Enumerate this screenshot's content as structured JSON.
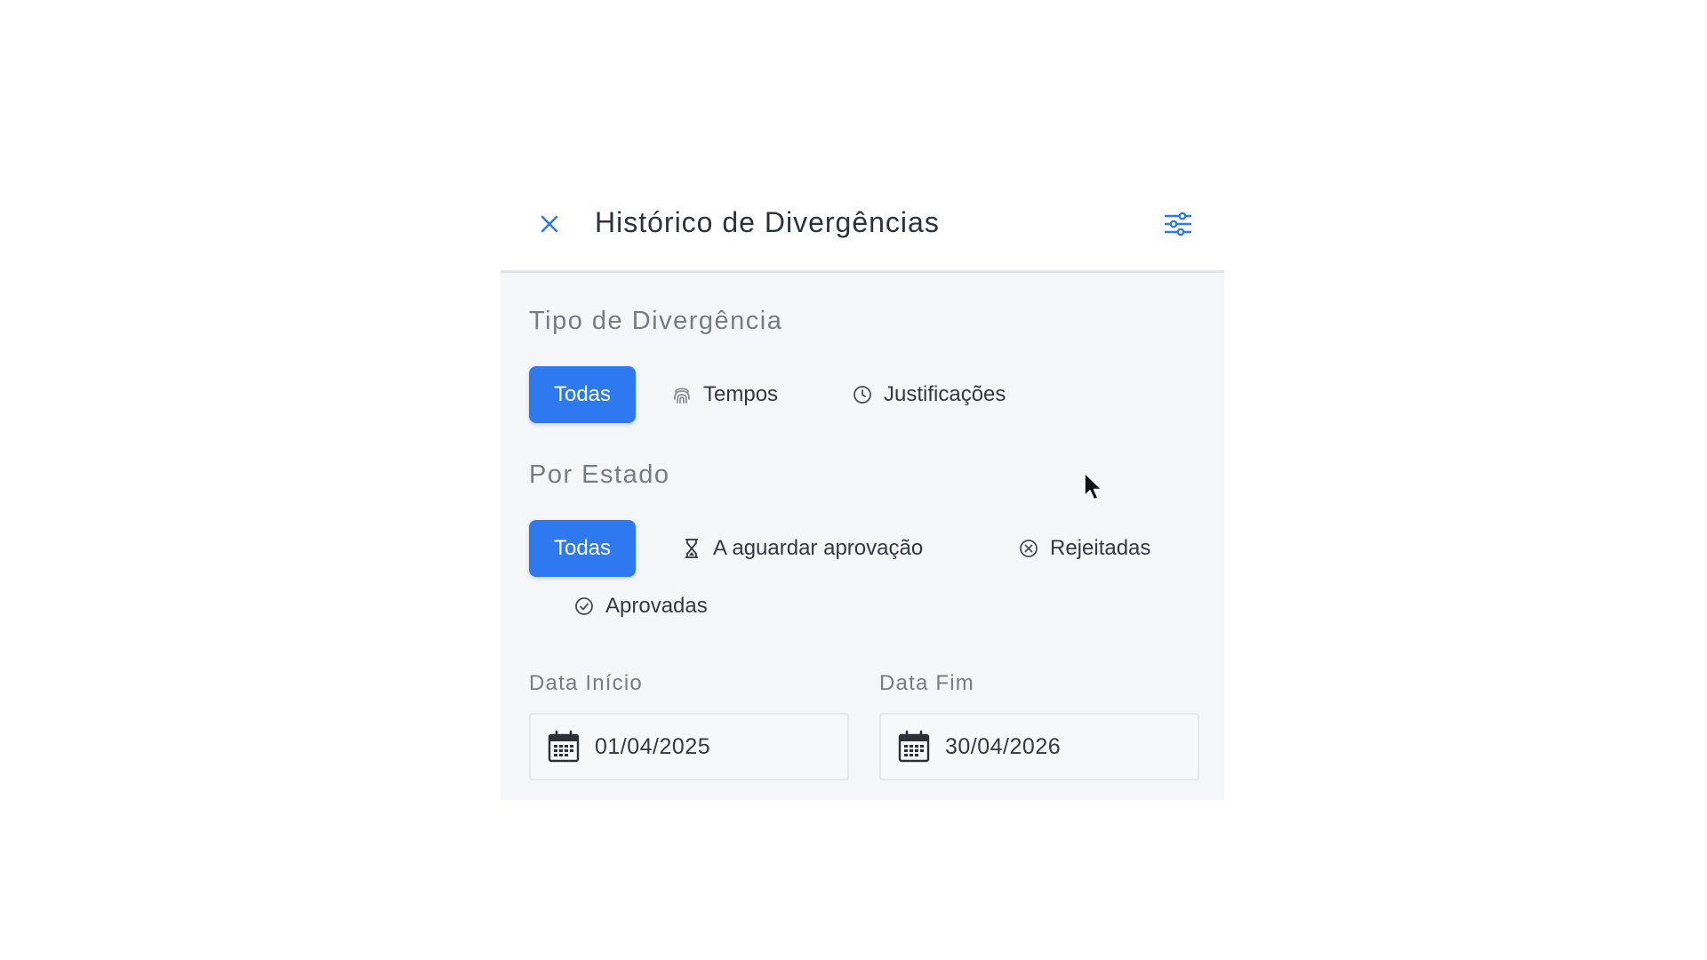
{
  "header": {
    "title": "Histórico de Divergências",
    "close_icon": "close-icon",
    "filter_icon": "sliders-icon",
    "accent": "#2e78f0"
  },
  "type_section": {
    "title": "Tipo de Divergência",
    "chips": [
      {
        "label": "Todas",
        "active": true
      },
      {
        "label": "Tempos",
        "icon": "fingerprint-icon",
        "active": false
      },
      {
        "label": "Justificações",
        "icon": "clock-icon",
        "active": false
      }
    ]
  },
  "state_section": {
    "title": "Por Estado",
    "chips": [
      {
        "label": "Todas",
        "active": true
      },
      {
        "label": "A aguardar aprovação",
        "icon": "hourglass-icon",
        "active": false
      },
      {
        "label": "Rejeitadas",
        "icon": "x-circle-icon",
        "active": false
      },
      {
        "label": "Aprovadas",
        "icon": "check-circle-icon",
        "active": false
      }
    ]
  },
  "dates": {
    "start": {
      "label": "Data Início",
      "value": "01/04/2025",
      "icon": "calendar-icon"
    },
    "end": {
      "label": "Data Fim",
      "value": "30/04/2026",
      "icon": "calendar-icon"
    }
  },
  "colors": {
    "active_chip": "#2e78f0",
    "panel_body": "#f5f6f8",
    "section_title": "#777b82"
  }
}
